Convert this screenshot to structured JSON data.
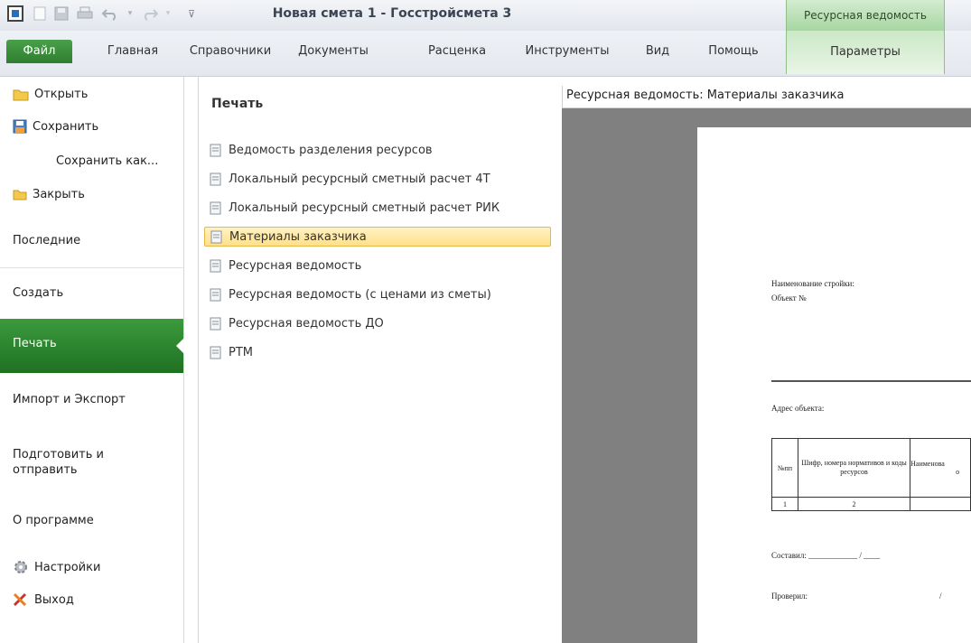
{
  "window": {
    "title": "Новая смета 1 - Госстройсмета 3",
    "context_tab_group": "Ресурсная ведомость"
  },
  "ribbon": {
    "tabs": [
      "Файл",
      "Главная",
      "Справочники",
      "Документы",
      "Расценка",
      "Инструменты",
      "Вид",
      "Помощь"
    ],
    "context_tab": "Параметры"
  },
  "backstage": {
    "commands": {
      "open": "Открыть",
      "save": "Сохранить",
      "save_as": "Сохранить как...",
      "close": "Закрыть"
    },
    "sections": {
      "recent": "Последние",
      "create": "Создать",
      "print": "Печать",
      "import_export": "Импорт и Экспорт",
      "prepare_send": "Подготовить и отправить",
      "about": "О программе"
    },
    "settings": "Настройки",
    "exit": "Выход"
  },
  "print_panel": {
    "title": "Печать",
    "reports": [
      "Ведомость разделения ресурсов",
      "Локальный ресурсный сметный расчет 4Т",
      "Локальный ресурсный сметный расчет РИК",
      "Материалы заказчика",
      "Ресурсная ведомость",
      "Ресурсная ведомость (с ценами из сметы)",
      "Ресурсная ведомость ДО",
      "РТМ"
    ],
    "selected_index": 3
  },
  "preview": {
    "header": "Ресурсная ведомость: Материалы заказчика",
    "sheet": {
      "line1": "Наименование стройки:",
      "line2": "Объект №",
      "address": "Адрес объекта:",
      "table_headers": [
        "№пп",
        "Шифр, номера нормативов и коды ресурсов",
        "Наименова"
      ],
      "table_row": [
        "1",
        "2",
        ""
      ],
      "table_cut": "о",
      "compiled": "Составил: ____________ / ____",
      "checked": "Проверил:",
      "checked_sep": "/"
    }
  },
  "colors": {
    "accent_green": "#2e7e30",
    "selection_yellow": "#ffe08a",
    "preview_gray": "#808080"
  }
}
